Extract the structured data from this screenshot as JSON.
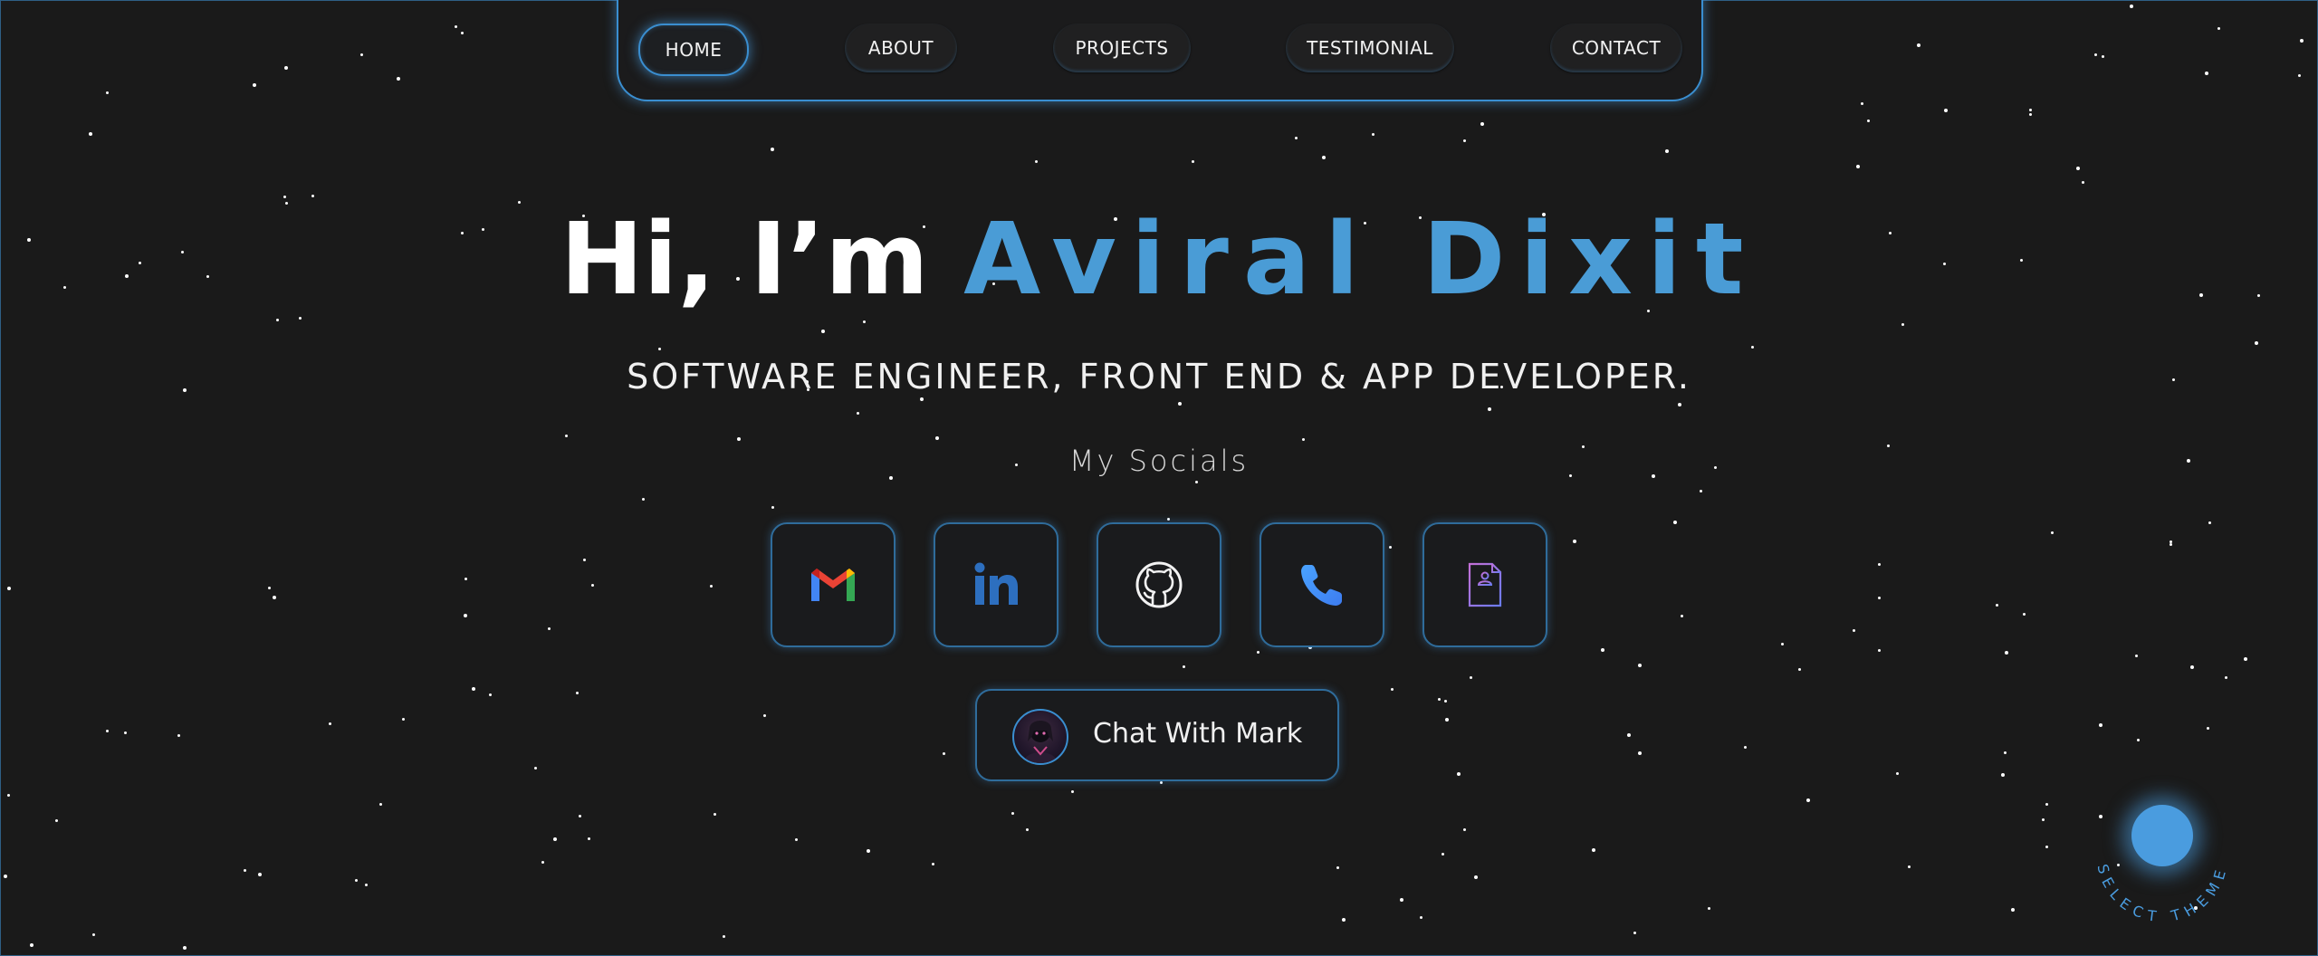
{
  "nav": {
    "items": [
      {
        "label": "HOME",
        "active": true
      },
      {
        "label": "ABOUT",
        "active": false
      },
      {
        "label": "PROJECTS",
        "active": false
      },
      {
        "label": "TESTIMONIAL",
        "active": false
      },
      {
        "label": "CONTACT",
        "active": false
      }
    ]
  },
  "hero": {
    "greeting": "Hi, I’m",
    "name": "Aviral Dixit",
    "subtitle": "SOFTWARE ENGINEER, FRONT END & APP DEVELOPER.",
    "socials_label": "My Socials"
  },
  "socials": [
    {
      "name": "gmail",
      "icon": "gmail-icon"
    },
    {
      "name": "linkedin",
      "icon": "linkedin-icon"
    },
    {
      "name": "github",
      "icon": "github-icon"
    },
    {
      "name": "phone",
      "icon": "phone-icon"
    },
    {
      "name": "resume",
      "icon": "resume-icon"
    }
  ],
  "chat": {
    "label": "Chat With Mark",
    "avatar_icon": "avatar-icon"
  },
  "theme": {
    "label": "SELECT THEME",
    "accent": "#4a9cdf"
  },
  "colors": {
    "background": "#1a1a1a",
    "accent": "#4a9cd6",
    "text": "#ffffff"
  }
}
